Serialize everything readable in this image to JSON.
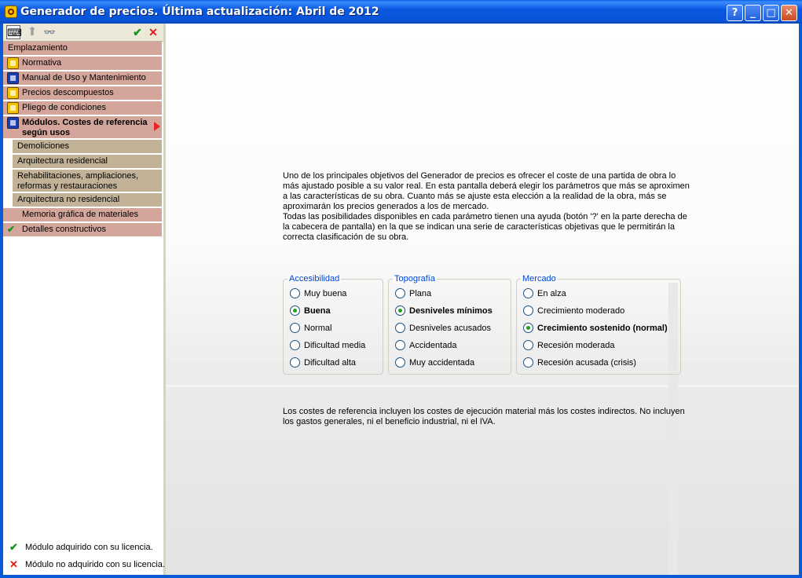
{
  "window": {
    "title": "Generador de precios. Última actualización: Abril de 2012",
    "buttons": {
      "help": "?",
      "minimize": "_",
      "maximize": "□",
      "close": "✕"
    }
  },
  "toolbar": {
    "ok": "✔",
    "cancel": "✕",
    "up": "⬆",
    "search": "👓",
    "keyboard": "⌨"
  },
  "sidebar": {
    "items": [
      {
        "label": "Emplazamiento"
      },
      {
        "label": "Normativa",
        "icon": "scales-icon"
      },
      {
        "label": "Manual de Uso y Mantenimiento",
        "icon": "wrench-icon"
      },
      {
        "label": "Precios descompuestos",
        "icon": "price-icon"
      },
      {
        "label": "Pliego de condiciones",
        "icon": "document-icon"
      },
      {
        "label": "Módulos. Costes de referencia según usos",
        "icon": "modules-icon"
      }
    ],
    "subitems": [
      "Demoliciones",
      "Arquitectura residencial",
      "Rehabilitaciones, ampliaciones, reformas y restauraciones",
      "Arquitectura no residencial"
    ],
    "extra_items": [
      {
        "label": "Memoria gráfica de materiales"
      },
      {
        "label": "Detalles constructivos"
      }
    ],
    "legend": {
      "acquired": "Módulo adquirido con su licencia.",
      "not_acquired": "Módulo no adquirido con su licencia."
    }
  },
  "main": {
    "intro_p1": "Uno de los principales objetivos del Generador de precios es ofrecer el coste de una partida de obra lo más ajustado posible a su valor real. En esta pantalla deberá elegir los parámetros que más se aproximen a las características de su obra. Cuanto más se ajuste esta elección a la realidad de la obra, más se aproximarán los precios generados a los de mercado.",
    "intro_p2": "Todas las posibilidades disponibles en cada parámetro tienen una ayuda (botón '?' en la parte derecha de la cabecera de pantalla) en la que se indican una serie de características objetivas que le permitirán la correcta clasificación de su obra.",
    "groups": [
      {
        "title": "Accesibilidad",
        "options": [
          "Muy buena",
          "Buena",
          "Normal",
          "Dificultad media",
          "Dificultad alta"
        ],
        "selected": 1
      },
      {
        "title": "Topografía",
        "options": [
          "Plana",
          "Desniveles mínimos",
          "Desniveles acusados",
          "Accidentada",
          "Muy accidentada"
        ],
        "selected": 1
      },
      {
        "title": "Mercado",
        "options": [
          "En alza",
          "Crecimiento moderado",
          "Crecimiento sostenido (normal)",
          "Recesión moderada",
          "Recesión acusada (crisis)"
        ],
        "selected": 2
      }
    ],
    "footer": "Los costes de referencia incluyen los costes de ejecución material más los costes indirectos. No incluyen los gastos generales, ni el beneficio industrial, ni el IVA."
  },
  "colors": {
    "sidebar_item": "#d4a59a",
    "sidebar_subitem": "#c2b298",
    "group_title": "#0046d5",
    "check": "#13961a",
    "cross": "#e01b1b"
  }
}
